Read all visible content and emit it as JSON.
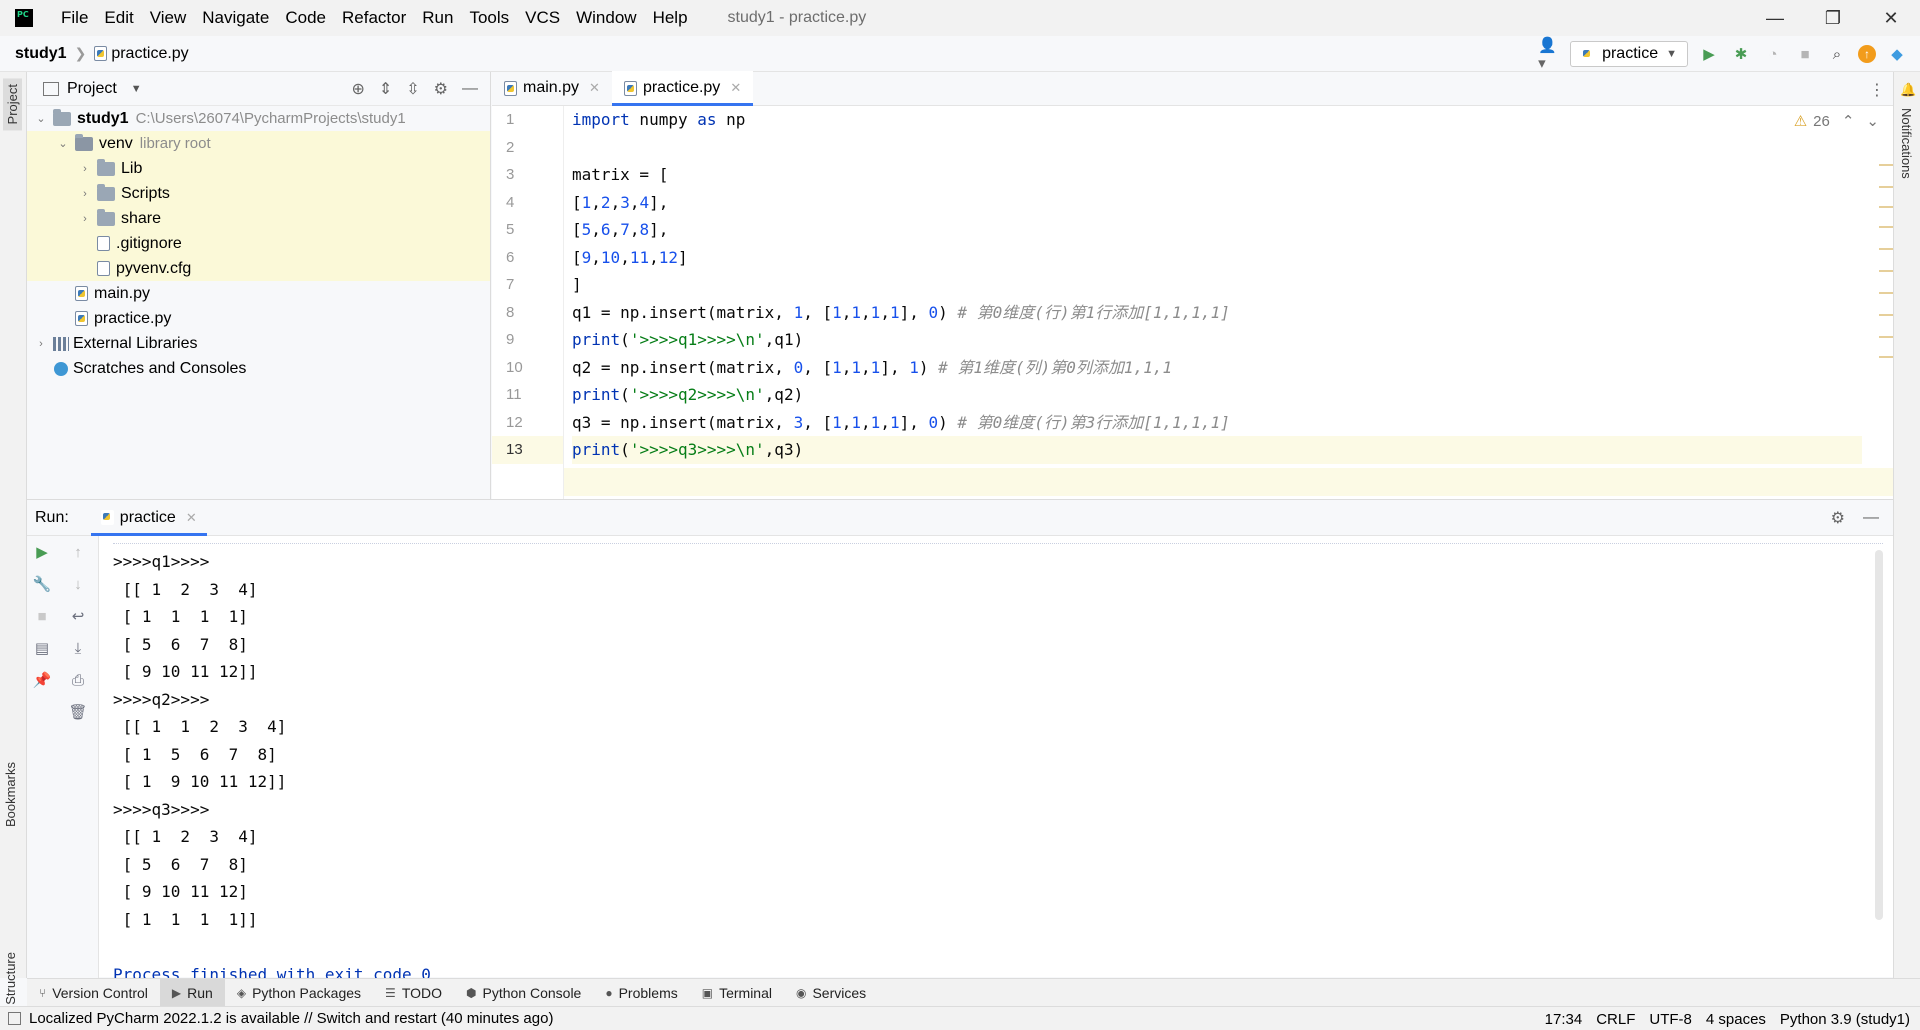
{
  "menu": [
    "File",
    "Edit",
    "View",
    "Navigate",
    "Code",
    "Refactor",
    "Run",
    "Tools",
    "VCS",
    "Window",
    "Help"
  ],
  "window_title": "study1 - practice.py",
  "window_controls": {
    "minimize": "—",
    "restore": "❐",
    "close": "✕"
  },
  "breadcrumb": {
    "project": "study1",
    "file": "practice.py"
  },
  "run_config": {
    "name": "practice"
  },
  "left_strip": {
    "project": "Project",
    "bookmarks": "Bookmarks",
    "structure": "Structure"
  },
  "right_strip": {
    "notifications": "Notifications"
  },
  "project_panel": {
    "title": "Project",
    "tree": [
      {
        "label": "study1",
        "hint": "C:\\Users\\26074\\PycharmProjects\\study1"
      },
      {
        "label": "venv",
        "hint": "library root"
      },
      {
        "label": "Lib"
      },
      {
        "label": "Scripts"
      },
      {
        "label": "share"
      },
      {
        "label": ".gitignore"
      },
      {
        "label": "pyvenv.cfg"
      },
      {
        "label": "main.py"
      },
      {
        "label": "practice.py"
      },
      {
        "label": "External Libraries"
      },
      {
        "label": "Scratches and Consoles"
      }
    ]
  },
  "editor": {
    "tabs": [
      {
        "label": "main.py",
        "active": false
      },
      {
        "label": "practice.py",
        "active": true
      }
    ],
    "warnings_count": "26",
    "line_numbers": [
      "1",
      "2",
      "3",
      "4",
      "5",
      "6",
      "7",
      "8",
      "9",
      "10",
      "11",
      "12",
      "13"
    ],
    "code_lines": [
      "import numpy as np",
      "",
      "matrix = [",
      "[1,2,3,4],",
      "[5,6,7,8],",
      "[9,10,11,12]",
      "]",
      "q1 = np.insert(matrix, 1, [1,1,1,1], 0) # 第0维度(行)第1行添加[1,1,1,1]",
      "print('>>>>q1>>>>\\n',q1)",
      "q2 = np.insert(matrix, 0, [1,1,1], 1) # 第1维度(列)第0列添加1,1,1",
      "print('>>>>q2>>>>\\n',q2)",
      "q3 = np.insert(matrix, 3, [1,1,1,1], 0) # 第0维度(行)第3行添加[1,1,1,1]",
      "print('>>>>q3>>>>\\n',q3)"
    ]
  },
  "run_panel": {
    "label": "Run:",
    "tab": "practice",
    "output": [
      ">>>>q1>>>>",
      " [[ 1  2  3  4]",
      " [ 1  1  1  1]",
      " [ 5  6  7  8]",
      " [ 9 10 11 12]]",
      ">>>>q2>>>>",
      " [[ 1  1  2  3  4]",
      " [ 1  5  6  7  8]",
      " [ 1  9 10 11 12]]",
      ">>>>q3>>>>",
      " [[ 1  2  3  4]",
      " [ 5  6  7  8]",
      " [ 9 10 11 12]",
      " [ 1  1  1  1]]",
      "",
      "Process finished with exit code 0"
    ]
  },
  "tool_tabs": [
    {
      "label": "Version Control",
      "icon": "⑂"
    },
    {
      "label": "Run",
      "icon": "▶"
    },
    {
      "label": "Python Packages",
      "icon": "◈"
    },
    {
      "label": "TODO",
      "icon": "☰"
    },
    {
      "label": "Python Console",
      "icon": "⬢"
    },
    {
      "label": "Problems",
      "icon": "●"
    },
    {
      "label": "Terminal",
      "icon": "▣"
    },
    {
      "label": "Services",
      "icon": "◉"
    }
  ],
  "status": {
    "message": "Localized PyCharm 2022.1.2 is available // Switch and restart (40 minutes ago)",
    "position": "17:34",
    "line_sep": "CRLF",
    "encoding": "UTF-8",
    "indent": "4 spaces",
    "interpreter": "Python 3.9 (study1)"
  },
  "colors": {
    "accent": "#3574f0",
    "keyword": "#0033b3",
    "number": "#1750eb",
    "string": "#067d17",
    "comment": "#8c8c8c",
    "highlight": "#fbf9d8"
  }
}
